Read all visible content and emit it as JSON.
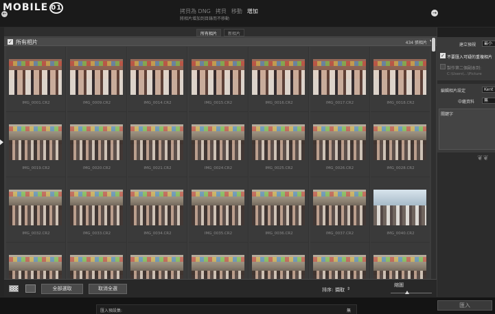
{
  "header": {
    "logo_text": "MOBILE",
    "logo_badge": "01",
    "modes": [
      {
        "label": "拷貝為 DNG",
        "active": false
      },
      {
        "label": "拷貝",
        "active": false
      },
      {
        "label": "移動",
        "active": false
      },
      {
        "label": "增加",
        "active": true
      }
    ],
    "mode_description": "將相片增加到目錄而不移動",
    "back_icon": "back-arrow-icon",
    "forward_icon": "forward-arrow-icon"
  },
  "view_tabs": [
    {
      "label": "所有相片",
      "active": true
    },
    {
      "label": "新相片",
      "active": false
    }
  ],
  "grid_header": {
    "title": "所有相片",
    "count": "434 張相片"
  },
  "photos": [
    "IMG_0001.CR2",
    "IMG_0009.CR2",
    "IMG_0014.CR2",
    "IMG_0015.CR2",
    "IMG_0016.CR2",
    "IMG_0017.CR2",
    "IMG_0018.CR2",
    "IMG_0019.CR2",
    "IMG_0020.CR2",
    "IMG_0021.CR2",
    "IMG_0024.CR2",
    "IMG_0025.CR2",
    "IMG_0026.CR2",
    "IMG_0028.CR2",
    "IMG_0032.CR2",
    "IMG_0033.CR2",
    "IMG_0034.CR2",
    "IMG_0035.CR2",
    "IMG_0036.CR2",
    "IMG_0037.CR2",
    "IMG_0040.CR2",
    "",
    "",
    "",
    "",
    "",
    "",
    ""
  ],
  "toolbar": {
    "check_all": "全部選取",
    "uncheck_all": "取消全選",
    "sort_label": "排序:",
    "sort_value": "擷取",
    "thumbnail_label": "縮圖"
  },
  "right_panel": {
    "preview_label": "建立預視",
    "preview_value": "最小",
    "dont_import_duplicates": "不要匯入可疑的重複相片",
    "second_copy_label": "製作第二個副本到:",
    "second_copy_path": "C:\\Users\\...\\Picture",
    "develop_settings_label": "編輯相片設定",
    "develop_settings_value": "Kent L",
    "metadata_label": "中繼資料",
    "metadata_value": "無",
    "keywords_label": "關鍵字"
  },
  "bottom": {
    "preset_label": "匯入預設集:",
    "preset_value": "無",
    "import_button": "匯入"
  }
}
